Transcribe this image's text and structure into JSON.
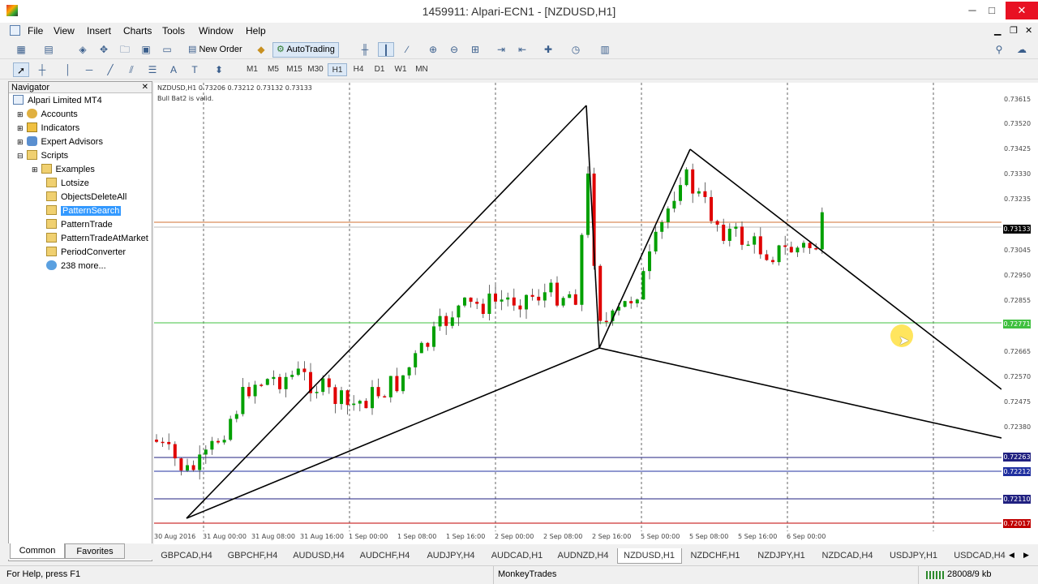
{
  "window": {
    "title": "1459911: Alpari-ECN1 - [NZDUSD,H1]"
  },
  "menu": [
    "File",
    "View",
    "Insert",
    "Charts",
    "Tools",
    "Window",
    "Help"
  ],
  "toolbar": {
    "new_order": "New Order",
    "auto_trading": "AutoTrading",
    "timeframes": [
      "M1",
      "M5",
      "M15",
      "M30",
      "H1",
      "H4",
      "D1",
      "W1",
      "MN"
    ],
    "active_timeframe": "H1"
  },
  "navigator": {
    "title": "Navigator",
    "items": [
      {
        "label": "Alpari Limited MT4",
        "icon": "terminal-icon"
      },
      {
        "label": "Accounts",
        "icon": "accounts-icon"
      },
      {
        "label": "Indicators",
        "icon": "indicators-icon"
      },
      {
        "label": "Expert Advisors",
        "icon": "expert-icon"
      },
      {
        "label": "Scripts",
        "icon": "scripts-icon"
      },
      {
        "label": "Examples",
        "icon": "script-icon"
      },
      {
        "label": "Lotsize",
        "icon": "script-icon"
      },
      {
        "label": "ObjectsDeleteAll",
        "icon": "script-icon"
      },
      {
        "label": "PatternSearch",
        "icon": "script-icon"
      },
      {
        "label": "PatternTrade",
        "icon": "script-icon"
      },
      {
        "label": "PatternTradeAtMarket",
        "icon": "script-icon"
      },
      {
        "label": "PeriodConverter",
        "icon": "script-icon"
      },
      {
        "label": "238 more...",
        "icon": "globe-icon"
      }
    ],
    "tabs": [
      "Common",
      "Favorites"
    ]
  },
  "chart": {
    "header": "NZDUSD,H1  0.73206 0.73212 0.73132 0.73133",
    "message": "Bull Bat2 is valid.",
    "price_labels": [
      "0.73615",
      "0.73520",
      "0.73425",
      "0.73330",
      "0.73235",
      "0.73133",
      "0.73045",
      "0.72950",
      "0.72855",
      "0.72771",
      "0.72665",
      "0.72570",
      "0.72475",
      "0.72380",
      "0.72263",
      "0.72212",
      "0.72110",
      "0.72017"
    ],
    "time_labels": [
      "30 Aug 2016",
      "31 Aug 00:00",
      "31 Aug 08:00",
      "31 Aug 16:00",
      "1 Sep 00:00",
      "1 Sep 08:00",
      "1 Sep 16:00",
      "2 Sep 00:00",
      "2 Sep 08:00",
      "2 Sep 16:00",
      "5 Sep 00:00",
      "5 Sep 08:00",
      "5 Sep 16:00",
      "6 Sep 00:00"
    ],
    "colors": {
      "bull": "#00a000",
      "bear": "#e00000",
      "orange_line": "#d07030",
      "green_line": "#40c040",
      "blue_line": "#202080",
      "red_line": "#c00000"
    }
  },
  "chart_tabs": [
    "GBPCAD,H4",
    "GBPCHF,H4",
    "AUDUSD,H4",
    "AUDCHF,H4",
    "AUDJPY,H4",
    "AUDCAD,H1",
    "AUDNZD,H4",
    "NZDUSD,H1",
    "NZDCHF,H1",
    "NZDJPY,H1",
    "NZDCAD,H4",
    "USDJPY,H1",
    "USDCAD,H4"
  ],
  "active_chart_tab": "NZDUSD,H1",
  "status": {
    "help": "For Help, press F1",
    "profile": "MonkeyTrades",
    "traffic": "28008/9 kb"
  }
}
